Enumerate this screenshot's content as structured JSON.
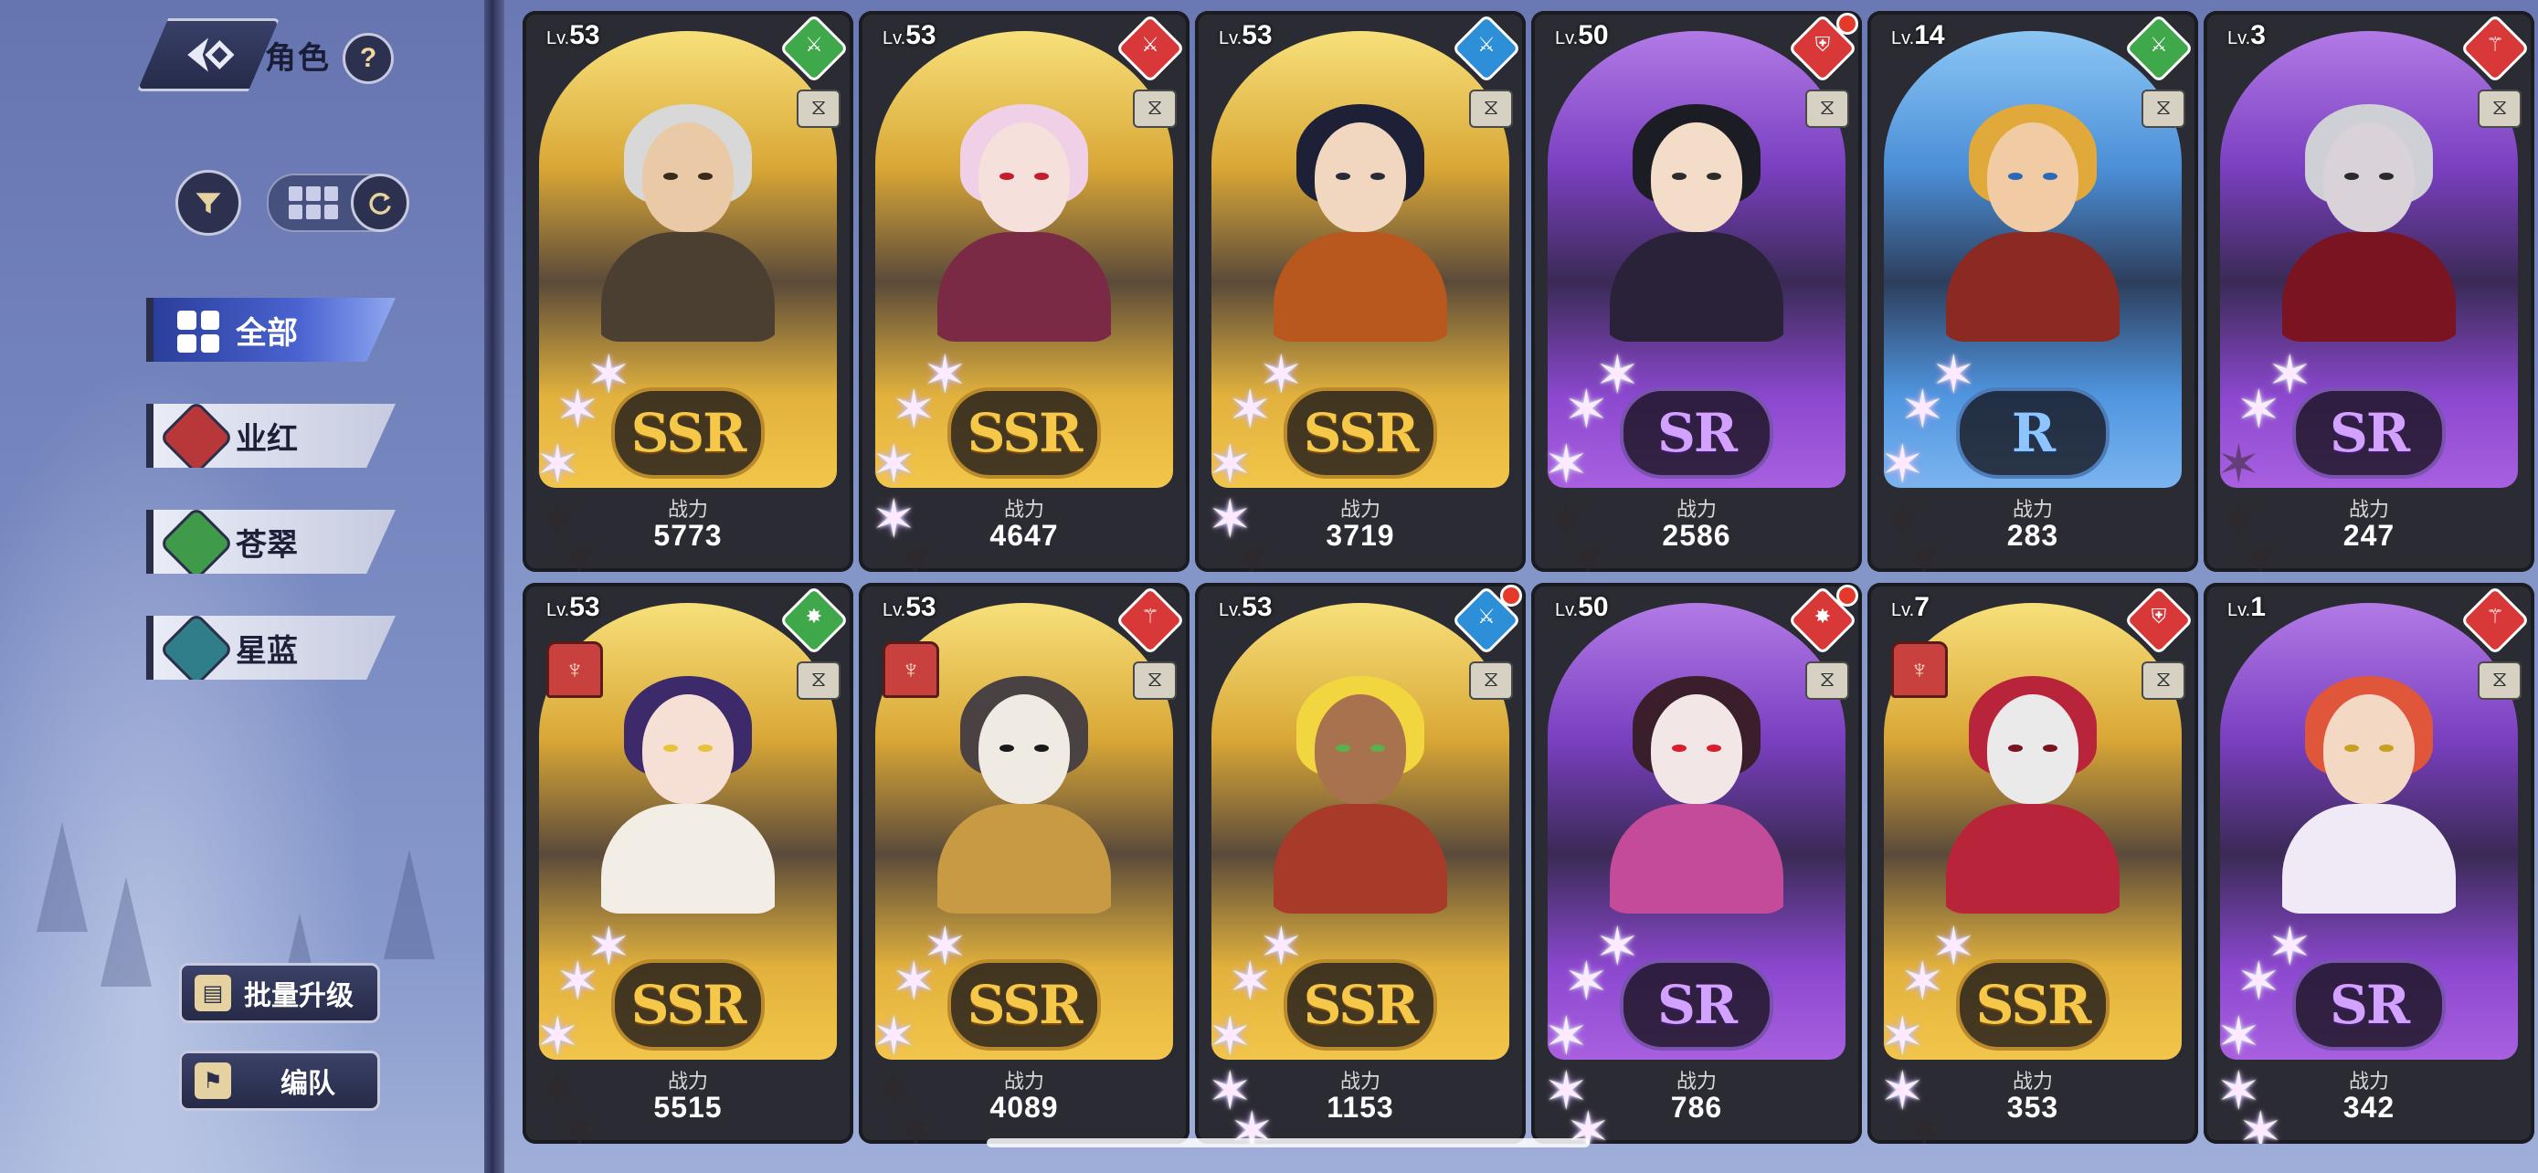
{
  "header": {
    "title": "角色",
    "help_label": "?"
  },
  "filters": {
    "tabs": [
      {
        "label": "全部",
        "active": true,
        "color": "#3b52c2"
      },
      {
        "label": "业红",
        "active": false,
        "color": "#b8383a"
      },
      {
        "label": "苍翠",
        "active": false,
        "color": "#3f9a4a"
      },
      {
        "label": "星蓝",
        "active": false,
        "color": "#2f7e8a"
      }
    ]
  },
  "buttons": {
    "batch_upgrade": "批量升级",
    "team": "编队"
  },
  "cards": [
    {
      "level": "53",
      "rarity": "SSR",
      "stars": 3,
      "power_label": "战力",
      "power": "5773",
      "class_color": "#3ea84a",
      "class_icon": "sword-icon",
      "reddot": false,
      "faction": false,
      "hair": "#d8d8d8",
      "skin": "#e9c9a6",
      "outfit": "#4a3f30",
      "eye": "#3a2a1a"
    },
    {
      "level": "53",
      "rarity": "SSR",
      "stars": 4,
      "power_label": "战力",
      "power": "4647",
      "class_color": "#d8383a",
      "class_icon": "sword-icon",
      "reddot": false,
      "faction": false,
      "hair": "#efd0e6",
      "skin": "#f6e0dc",
      "outfit": "#7a2a45",
      "eye": "#c21e2e"
    },
    {
      "level": "53",
      "rarity": "SSR",
      "stars": 4,
      "power_label": "战力",
      "power": "3719",
      "class_color": "#2c8fd8",
      "class_icon": "sword-icon",
      "reddot": false,
      "faction": false,
      "hair": "#1d2036",
      "skin": "#f1d6c0",
      "outfit": "#b8571e",
      "eye": "#2a2a3a"
    },
    {
      "level": "50",
      "rarity": "SR",
      "stars": 3,
      "power_label": "战力",
      "power": "2586",
      "class_color": "#d83838",
      "class_icon": "shield-icon",
      "reddot": true,
      "faction": false,
      "hair": "#1c1c24",
      "skin": "#f3dcc8",
      "outfit": "#2a2238",
      "eye": "#2c2c2c"
    },
    {
      "level": "14",
      "rarity": "R",
      "stars": 3,
      "power_label": "战力",
      "power": "283",
      "class_color": "#3ea84a",
      "class_icon": "sword-icon",
      "reddot": false,
      "faction": false,
      "hair": "#e0a93a",
      "skin": "#f0cba4",
      "outfit": "#8a2a22",
      "eye": "#2c68b8"
    },
    {
      "level": "3",
      "rarity": "SR",
      "stars": 2,
      "power_label": "战力",
      "power": "247",
      "class_color": "#d83838",
      "class_icon": "staff-icon",
      "reddot": false,
      "faction": false,
      "hair": "#cfcfd6",
      "skin": "#d9d2d8",
      "outfit": "#7a1420",
      "eye": "#2a2a2a"
    },
    {
      "level": "53",
      "rarity": "SSR",
      "stars": 3,
      "power_label": "战力",
      "power": "5515",
      "class_color": "#3ea84a",
      "class_icon": "flame-icon",
      "reddot": false,
      "faction": true,
      "hair": "#3c2a6a",
      "skin": "#f6e0d6",
      "outfit": "#f2eee6",
      "eye": "#e8c23a"
    },
    {
      "level": "53",
      "rarity": "SSR",
      "stars": 3,
      "power_label": "战力",
      "power": "4089",
      "class_color": "#d83838",
      "class_icon": "staff-icon",
      "reddot": false,
      "faction": true,
      "hair": "#4a4242",
      "skin": "#f0ebe2",
      "outfit": "#c89a44",
      "eye": "#1a1a1a"
    },
    {
      "level": "53",
      "rarity": "SSR",
      "stars": 5,
      "power_label": "战力",
      "power": "1153",
      "class_color": "#2c8fd8",
      "class_icon": "sword-icon",
      "reddot": true,
      "faction": false,
      "hair": "#f2d640",
      "skin": "#a8724e",
      "outfit": "#a83a2a",
      "eye": "#5ab04a"
    },
    {
      "level": "50",
      "rarity": "SR",
      "stars": 5,
      "power_label": "战力",
      "power": "786",
      "class_color": "#d83838",
      "class_icon": "flame-icon",
      "reddot": true,
      "faction": false,
      "hair": "#3a1e2c",
      "skin": "#f2e6e6",
      "outfit": "#c44a9a",
      "eye": "#d81e2a"
    },
    {
      "level": "7",
      "rarity": "SSR",
      "stars": 4,
      "power_label": "战力",
      "power": "353",
      "class_color": "#d83838",
      "class_icon": "shield-icon",
      "reddot": false,
      "faction": true,
      "hair": "#b8243a",
      "skin": "#eaeaea",
      "outfit": "#b8243a",
      "eye": "#7a1420"
    },
    {
      "level": "1",
      "rarity": "SR",
      "stars": 5,
      "power_label": "战力",
      "power": "342",
      "class_color": "#d83838",
      "class_icon": "staff-icon",
      "reddot": false,
      "faction": false,
      "hair": "#e0563a",
      "skin": "#f3d8c4",
      "outfit": "#f0eaf6",
      "eye": "#c8a020"
    }
  ]
}
